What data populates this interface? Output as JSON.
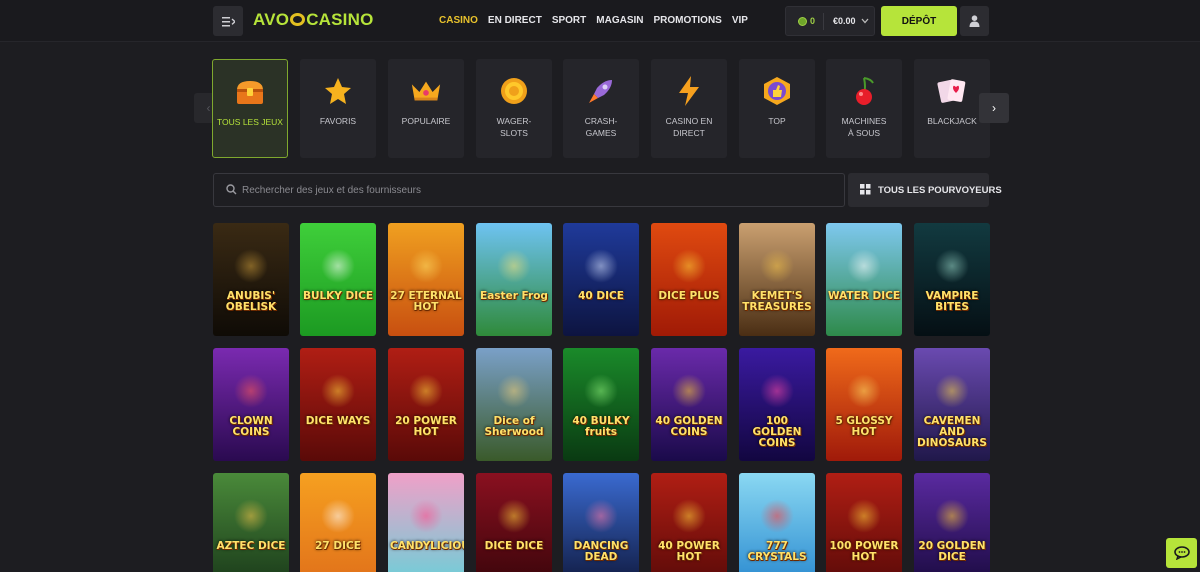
{
  "header": {
    "logo_left": "AVO",
    "logo_right": "CASINO",
    "nav": [
      {
        "label": "CASINO",
        "active": true
      },
      {
        "label": "EN DIRECT",
        "active": false
      },
      {
        "label": "SPORT",
        "active": false
      },
      {
        "label": "MAGASIN",
        "active": false
      },
      {
        "label": "PROMOTIONS",
        "active": false
      },
      {
        "label": "VIP",
        "active": false
      }
    ],
    "coins": "0",
    "balance": "€0.00",
    "deposit_label": "DÉPÔT"
  },
  "categories": [
    {
      "label": "TOUS LES JEUX",
      "icon": "treasure-chest-icon",
      "active": true
    },
    {
      "label": "FAVORIS",
      "icon": "star-icon",
      "active": false
    },
    {
      "label": "POPULAIRE",
      "icon": "crown-icon",
      "active": false
    },
    {
      "label": "WAGER-SLOTS",
      "icon": "gold-coin-icon",
      "active": false
    },
    {
      "label": "CRASH-GAMES",
      "icon": "rocket-icon",
      "active": false
    },
    {
      "label": "CASINO EN DIRECT",
      "icon": "lightning-icon",
      "active": false
    },
    {
      "label": "TOP",
      "icon": "thumbs-up-badge-icon",
      "active": false
    },
    {
      "label": "MACHINES À SOUS",
      "icon": "cherry-icon",
      "active": false
    },
    {
      "label": "BLACKJACK",
      "icon": "playing-cards-icon",
      "active": false
    }
  ],
  "search": {
    "placeholder": "Rechercher des jeux et des fournisseurs"
  },
  "providers_label": "TOUS LES POURVOYEURS",
  "games": [
    {
      "title": "ANUBIS' OBELISK",
      "bg1": "#3a2a14",
      "bg2": "#0f0b06",
      "accent": "#c99a3a"
    },
    {
      "title": "BULKY DICE",
      "bg1": "#3fcf3a",
      "bg2": "#1c9a22",
      "accent": "#ffffff"
    },
    {
      "title": "27 ETERNAL HOT",
      "bg1": "#f0a020",
      "bg2": "#c84f10",
      "accent": "#ffe066"
    },
    {
      "title": "Easter Frog",
      "bg1": "#6ec3f2",
      "bg2": "#2f8a3a",
      "accent": "#f6e27a"
    },
    {
      "title": "40 DICE",
      "bg1": "#1f3a9a",
      "bg2": "#0d1440",
      "accent": "#d7e3ff"
    },
    {
      "title": "DICE PLUS",
      "bg1": "#e04a10",
      "bg2": "#a01a06",
      "accent": "#ffd23a"
    },
    {
      "title": "KEMET'S TREASURES",
      "bg1": "#caa070",
      "bg2": "#4a2e14",
      "accent": "#f2c24a"
    },
    {
      "title": "WATER DICE",
      "bg1": "#7ec8ef",
      "bg2": "#2e8a4a",
      "accent": "#ffffff"
    },
    {
      "title": "VAMPIRE BITES",
      "bg1": "#123a40",
      "bg2": "#050f14",
      "accent": "#9ad7c8"
    },
    {
      "title": "CLOWN COINS",
      "bg1": "#7a2ab0",
      "bg2": "#2a0a50",
      "accent": "#ff5a5a"
    },
    {
      "title": "DICE WAYS",
      "bg1": "#b01e14",
      "bg2": "#5a0a08",
      "accent": "#ffd23a"
    },
    {
      "title": "20 POWER HOT",
      "bg1": "#b01e14",
      "bg2": "#5a0a08",
      "accent": "#ffd23a"
    },
    {
      "title": "Dice of Sherwood",
      "bg1": "#7aa0c8",
      "bg2": "#3a5a2a",
      "accent": "#f2d07a"
    },
    {
      "title": "40 BULKY fruits",
      "bg1": "#1a8a2a",
      "bg2": "#0a3a12",
      "accent": "#8ef07a"
    },
    {
      "title": "40 GOLDEN COINS",
      "bg1": "#6a2aaa",
      "bg2": "#1a0a4a",
      "accent": "#ffcc33"
    },
    {
      "title": "100 GOLDEN COINS",
      "bg1": "#3a1aa0",
      "bg2": "#120640",
      "accent": "#ff4aa8"
    },
    {
      "title": "5 GLOSSY HOT",
      "bg1": "#f06a1a",
      "bg2": "#a01a0a",
      "accent": "#ffe066"
    },
    {
      "title": "CAVEMEN AND DINOSAURS",
      "bg1": "#6a4ab0",
      "bg2": "#20184a",
      "accent": "#f6d24a"
    },
    {
      "title": "AZTEC DICE",
      "bg1": "#4a8a3a",
      "bg2": "#1a3a1a",
      "accent": "#f2c24a"
    },
    {
      "title": "27 DICE",
      "bg1": "#f6a020",
      "bg2": "#e0701a",
      "accent": "#ffffff"
    },
    {
      "title": "CANDYLICIOUS",
      "bg1": "#f0a0c8",
      "bg2": "#6ad0d8",
      "accent": "#ff4a8a"
    },
    {
      "title": "DICE DICE",
      "bg1": "#8a1020",
      "bg2": "#3a050a",
      "accent": "#ffd23a"
    },
    {
      "title": "DANCING DEAD",
      "bg1": "#3a6ad0",
      "bg2": "#101a40",
      "accent": "#ff7aa8"
    },
    {
      "title": "40 POWER HOT",
      "bg1": "#b01e14",
      "bg2": "#5a0a08",
      "accent": "#ffd23a"
    },
    {
      "title": "777 CRYSTALS",
      "bg1": "#8ad8f2",
      "bg2": "#2a8ad0",
      "accent": "#ff3a3a"
    },
    {
      "title": "100 POWER HOT",
      "bg1": "#b01e14",
      "bg2": "#5a0a08",
      "accent": "#ffd23a"
    },
    {
      "title": "20 GOLDEN DICE",
      "bg1": "#5a2aa0",
      "bg2": "#1a0a40",
      "accent": "#ffcc33"
    }
  ]
}
